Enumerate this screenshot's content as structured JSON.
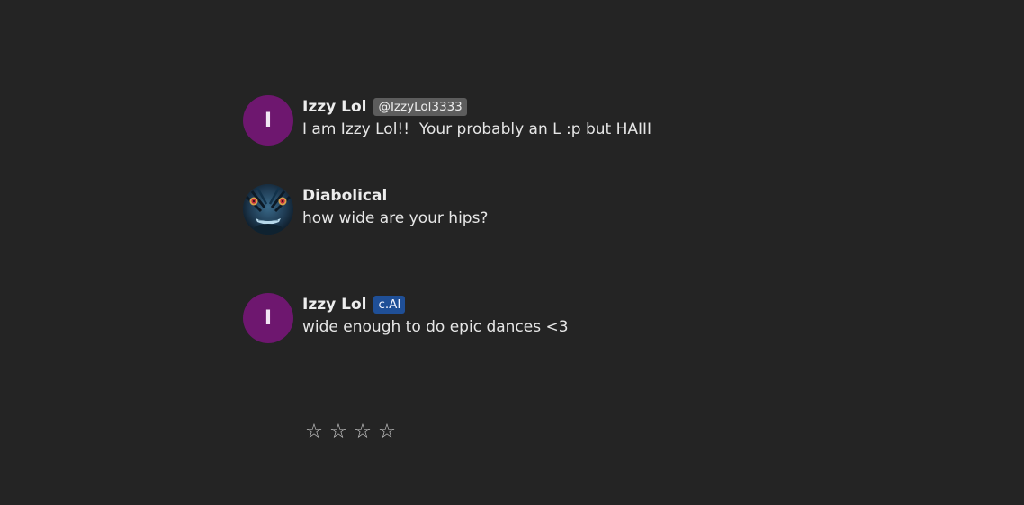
{
  "messages": [
    {
      "avatar_letter": "I",
      "name": "Izzy Lol",
      "badge": "@IzzyLol3333",
      "text": "I am Izzy Lol!!  Your probably an L :p but HAIII"
    },
    {
      "avatar_icon": "masked-face-avatar",
      "name": "Diabolical",
      "text": "how wide are your hips?"
    },
    {
      "avatar_letter": "I",
      "name": "Izzy Lol",
      "badge": "c.AI",
      "text": "wide enough to do epic dances <3"
    }
  ],
  "rating": {
    "stars": [
      "☆",
      "☆",
      "☆",
      "☆"
    ],
    "value": 0,
    "max": 4
  },
  "colors": {
    "background": "#242424",
    "avatar_purple": "#6e176f",
    "handle_badge": "#5d5d5d",
    "cai_badge": "#1f4f97"
  }
}
